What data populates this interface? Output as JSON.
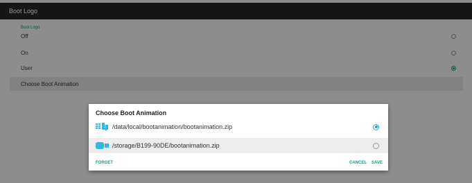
{
  "appbar": {
    "title": "Boot Logo"
  },
  "settings": {
    "section_header": "Boot Logo",
    "options": [
      {
        "label": "Off",
        "selected": false
      },
      {
        "label": "On",
        "selected": false
      },
      {
        "label": "User",
        "selected": true
      }
    ],
    "choose_animation_label": "Choose Boot Animation"
  },
  "dialog": {
    "title": "Choose Boot Animation",
    "items": [
      {
        "path": "/data/local/bootanimation/bootanimation.zip",
        "icon": "sd-card-icon",
        "selected": true
      },
      {
        "path": "/storage/B199-90DE/bootanimation.zip",
        "icon": "usb-drive-icon",
        "selected": false
      }
    ],
    "forget_label": "FORGET",
    "cancel_label": "CANCEL",
    "save_label": "SAVE"
  },
  "colors": {
    "appbar": "#23272a",
    "accent": "#1a9a8a",
    "radio_selected": "#2aa0d8"
  }
}
